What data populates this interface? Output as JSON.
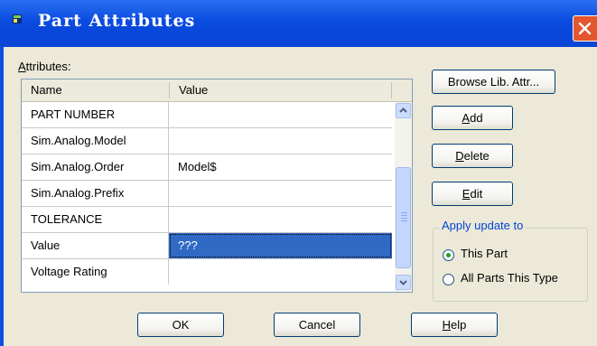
{
  "window": {
    "title": "Part Attributes"
  },
  "attributes_label": {
    "mnemonic": "A",
    "rest": "ttributes:"
  },
  "columns": {
    "name": "Name",
    "value": "Value"
  },
  "rows": [
    {
      "name": "PART NUMBER",
      "value": ""
    },
    {
      "name": "Sim.Analog.Model",
      "value": ""
    },
    {
      "name": "Sim.Analog.Order",
      "value": "Model$"
    },
    {
      "name": "Sim.Analog.Prefix",
      "value": ""
    },
    {
      "name": "TOLERANCE",
      "value": ""
    },
    {
      "name": "Value",
      "value": "???"
    },
    {
      "name": "Voltage Rating",
      "value": ""
    }
  ],
  "selected_row": "Value",
  "side_buttons": {
    "browse": "Browse Lib. Attr...",
    "add": {
      "mnemonic": "A",
      "rest": "dd"
    },
    "delete": {
      "mnemonic": "D",
      "rest": "elete"
    },
    "edit": {
      "mnemonic": "E",
      "rest": "dit"
    }
  },
  "apply_group": {
    "title": "Apply update to",
    "options": [
      "This Part",
      "All Parts This Type"
    ],
    "selected": "This Part"
  },
  "bottom_buttons": {
    "ok": "OK",
    "cancel": "Cancel",
    "help": {
      "mnemonic": "H",
      "rest": "elp"
    }
  },
  "colors": {
    "titlebar": "#0a4be0",
    "selection": "#316ac5",
    "close": "#e3562e",
    "group_title": "#0046d5"
  },
  "icons": {
    "title": "app-icon",
    "close": "close-icon",
    "scroll_up": "arrow-up-icon",
    "scroll_down": "arrow-down-icon"
  }
}
